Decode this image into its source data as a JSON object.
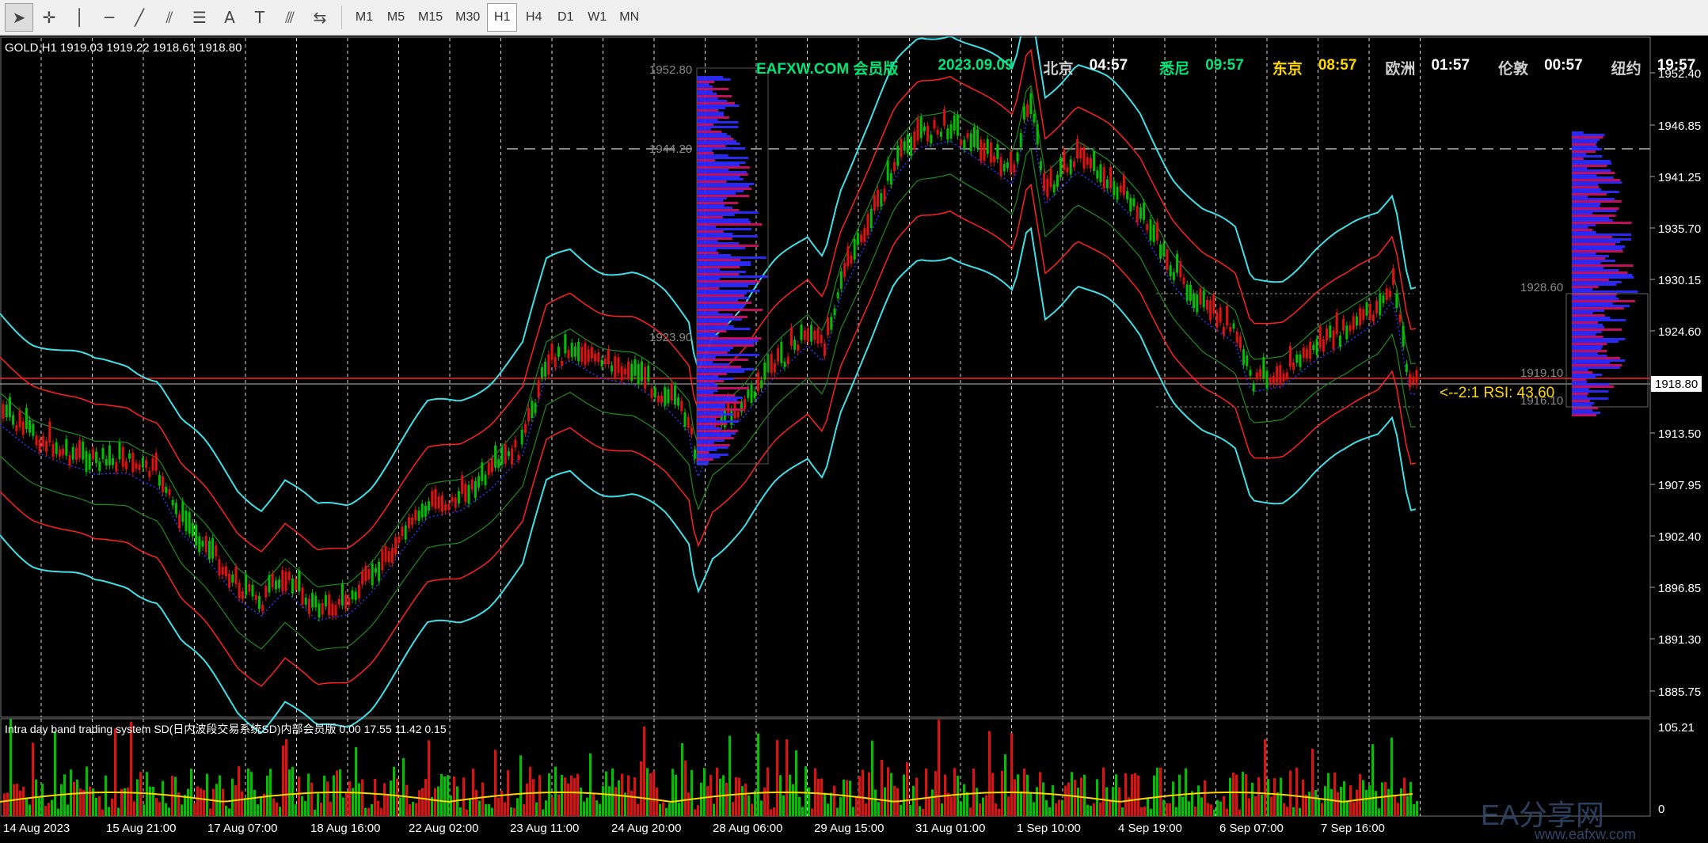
{
  "toolbar": {
    "tools": [
      {
        "name": "cursor-icon",
        "glyph": "➤"
      },
      {
        "name": "crosshair-icon",
        "glyph": "✛"
      },
      {
        "name": "vertical-line-icon",
        "glyph": "│"
      },
      {
        "name": "horizontal-line-icon",
        "glyph": "─"
      },
      {
        "name": "trendline-icon",
        "glyph": "╱"
      },
      {
        "name": "channel-icon",
        "glyph": "⫽"
      },
      {
        "name": "fibonacci-icon",
        "glyph": "☰"
      },
      {
        "name": "text-icon",
        "glyph": "A"
      },
      {
        "name": "text-label-icon",
        "glyph": "T"
      },
      {
        "name": "andrews-pitchfork-icon",
        "glyph": "⫻"
      },
      {
        "name": "arrows-icon",
        "glyph": "⇆"
      }
    ],
    "timeframes": [
      "M1",
      "M5",
      "M15",
      "M30",
      "H1",
      "H4",
      "D1",
      "W1",
      "MN"
    ],
    "active_timeframe": "H1"
  },
  "chart": {
    "info_line": "GOLD,H1  1919.03 1919.22 1918.61 1918.80",
    "price_labels": [
      "1952.40",
      "1946.85",
      "1941.25",
      "1935.70",
      "1930.15",
      "1924.60",
      "1913.50",
      "1907.95",
      "1902.40",
      "1896.85",
      "1891.30",
      "1885.75"
    ],
    "current_price": "1918.80",
    "date_labels": [
      "14 Aug 2023",
      "15 Aug 21:00",
      "17 Aug 07:00",
      "18 Aug 16:00",
      "22 Aug 02:00",
      "23 Aug 11:00",
      "24 Aug 20:00",
      "28 Aug 06:00",
      "29 Aug 15:00",
      "31 Aug 01:00",
      "1 Sep 10:00",
      "4 Sep 19:00",
      "6 Sep 07:00",
      "7 Sep 16:00"
    ],
    "profile_labels": [
      "1952.80",
      "1944.20",
      "1923.90",
      "1928.60",
      "1919.10",
      "1916.10"
    ],
    "clock": [
      {
        "text": "EAFXW.COM 会员版",
        "color": "#00e676"
      },
      {
        "text": "2023.09.09",
        "color": "#00e676"
      },
      {
        "text": "北京",
        "color": "#cfcfcf"
      },
      {
        "text": "04:57",
        "color": "#ffffff"
      },
      {
        "text": "悉尼",
        "color": "#00e676"
      },
      {
        "text": "09:57",
        "color": "#00e676"
      },
      {
        "text": "东京",
        "color": "#ffd700"
      },
      {
        "text": "08:57",
        "color": "#ffd700"
      },
      {
        "text": "欧洲",
        "color": "#cfcfcf"
      },
      {
        "text": "01:57",
        "color": "#ffffff"
      },
      {
        "text": "伦敦",
        "color": "#cfcfcf"
      },
      {
        "text": "00:57",
        "color": "#ffffff"
      },
      {
        "text": "纽约",
        "color": "#cfcfcf"
      },
      {
        "text": "19:57",
        "color": "#ffffff"
      }
    ],
    "rsi_text": "<--2:1  RSI: 43.60",
    "subwindow_title": "Intra day band trading system SD(日内波段交易系统SD)内部会员版 0.00 17.55 11.42 0.15",
    "subwindow_scale": [
      "105.21",
      "0"
    ],
    "watermark": "EA分享网",
    "watermark_url": "www.eafxw.com",
    "colors": {
      "bull": "#00c000",
      "bear": "#e01010",
      "outer_band": "#40e0e8",
      "mid_band": "#ff2020",
      "inner_band": "#1e8b1e",
      "profile_blue": "#2b2bff",
      "profile_red": "#cc1060",
      "grid": "#ffffff",
      "yellow": "#ffd700"
    }
  }
}
